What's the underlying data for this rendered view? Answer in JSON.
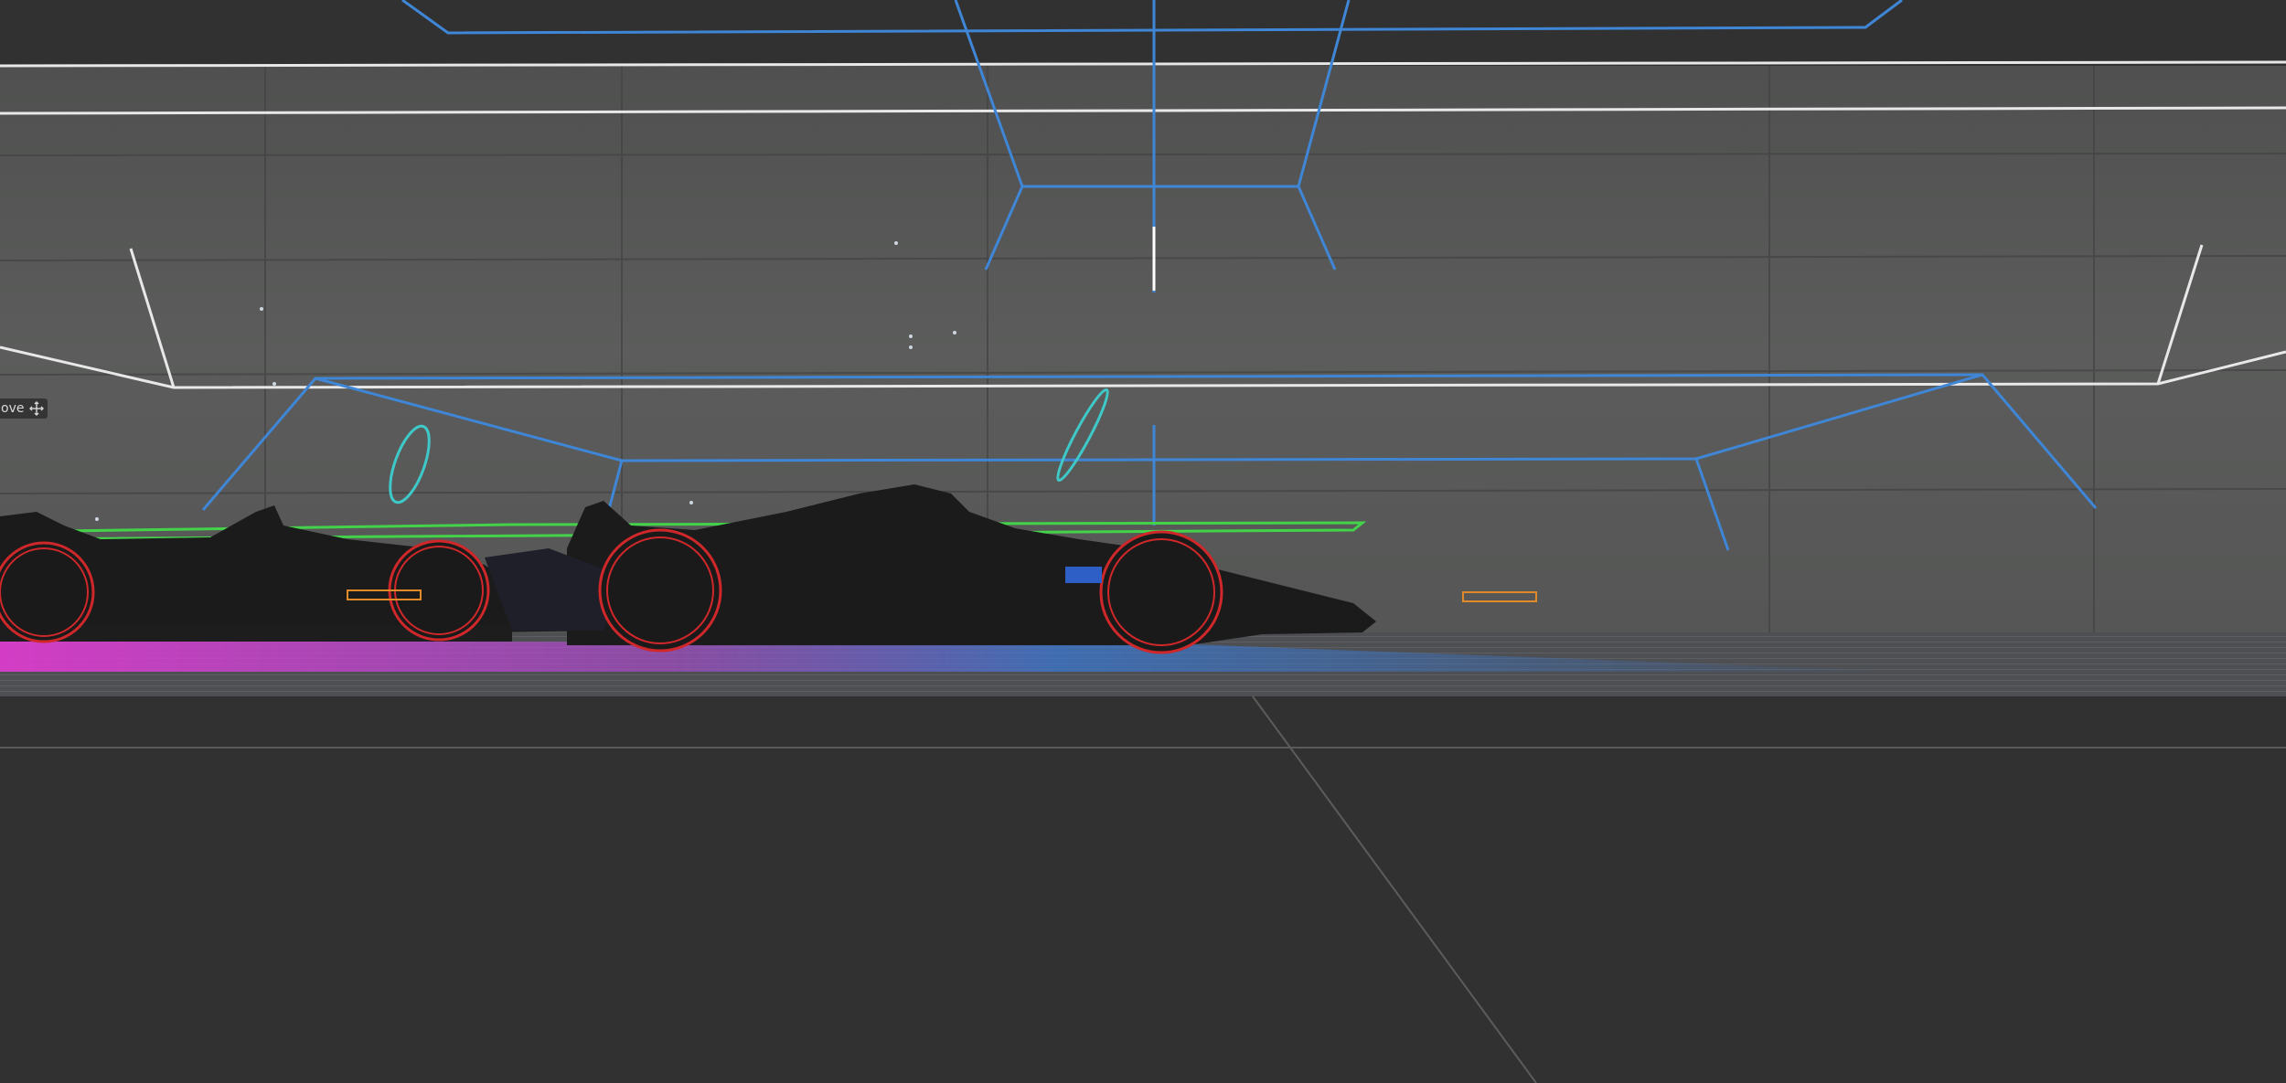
{
  "viewport": {
    "name": "3d-scene-viewport",
    "background": "#313131",
    "wall_color": "#5a5b5a",
    "floor_color": "#313131"
  },
  "tool_overlay": {
    "label": "ove",
    "icon": "move-arrows-icon"
  },
  "overlay_colors": {
    "camera_frustum": "#3f86d6",
    "room_outline": "#e8e8e8",
    "wheel_outline": "#d0282a",
    "light_ring": "#3fc8c8",
    "ground_plane": "#44d24a",
    "emitter": "#e08a2a",
    "floor_glow_magenta": "#e23bd2",
    "floor_glow_blue": "#3a7ad8"
  },
  "objects": [
    {
      "name": "race-car-front",
      "type": "mesh"
    },
    {
      "name": "race-car-rear",
      "type": "mesh"
    },
    {
      "name": "camera-frustum-gizmo",
      "type": "gizmo"
    },
    {
      "name": "area-light-gizmo",
      "type": "gizmo"
    }
  ]
}
